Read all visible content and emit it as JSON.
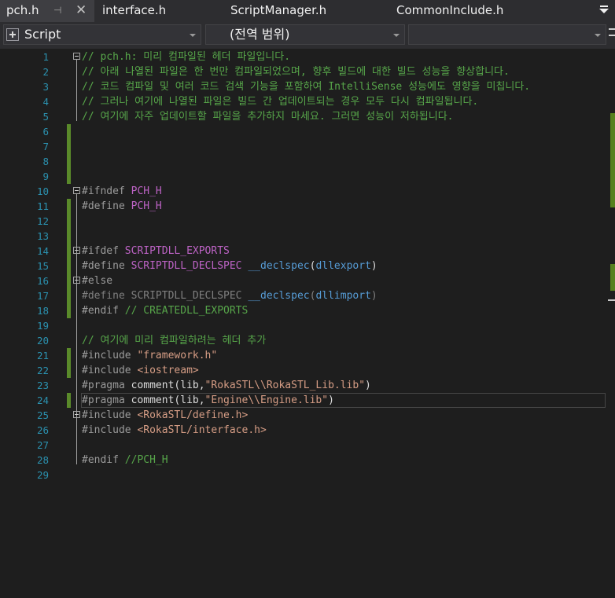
{
  "tabs": [
    {
      "label": "pch.h",
      "active": true
    },
    {
      "label": "interface.h"
    },
    {
      "label": "ScriptManager.h"
    },
    {
      "label": "CommonInclude.h"
    }
  ],
  "navbar": {
    "project": "Script",
    "scope": "(전역 범위)",
    "member": ""
  },
  "colors": {
    "changed": "#5a8a2a",
    "line_number": "#2b91af",
    "comment": "#57a64a",
    "macro": "#bd63c5",
    "string": "#d69d85",
    "keyword": "#569cd6"
  },
  "editor": {
    "line_numbers": [
      "1",
      "2",
      "3",
      "4",
      "5",
      "6",
      "7",
      "8",
      "9",
      "10",
      "11",
      "12",
      "13",
      "14",
      "15",
      "16",
      "17",
      "18",
      "19",
      "20",
      "21",
      "22",
      "23",
      "24",
      "25",
      "26",
      "27",
      "28",
      "29"
    ],
    "lines": [
      {
        "parts": [
          {
            "t": "// pch.h: 미리 컴파일된 헤더 파일입니다.",
            "c": "cmt"
          }
        ]
      },
      {
        "parts": [
          {
            "t": "// 아래 나열된 파일은 한 번만 컴파일되었으며, 향후 빌드에 대한 빌드 성능을 향상합니다.",
            "c": "cmt"
          }
        ]
      },
      {
        "parts": [
          {
            "t": "// 코드 컴파일 및 여러 코드 검색 기능을 포함하여 IntelliSense 성능에도 영향을 미칩니다.",
            "c": "cmt"
          }
        ]
      },
      {
        "parts": [
          {
            "t": "// 그러나 여기에 나열된 파일은 빌드 간 업데이트되는 경우 모두 다시 컴파일됩니다.",
            "c": "cmt"
          }
        ]
      },
      {
        "parts": [
          {
            "t": "// 여기에 자주 업데이트할 파일을 추가하지 마세요. 그러면 성능이 저하됩니다.",
            "c": "cmt"
          }
        ]
      },
      {
        "parts": []
      },
      {
        "parts": []
      },
      {
        "parts": []
      },
      {
        "parts": []
      },
      {
        "parts": [
          {
            "t": "#ifndef ",
            "c": "pre"
          },
          {
            "t": "PCH_H",
            "c": "mac"
          }
        ]
      },
      {
        "parts": [
          {
            "t": "#define ",
            "c": "pre"
          },
          {
            "t": "PCH_H",
            "c": "mac"
          }
        ]
      },
      {
        "parts": []
      },
      {
        "parts": []
      },
      {
        "parts": [
          {
            "t": "#ifdef ",
            "c": "pre"
          },
          {
            "t": "SCRIPTDLL_EXPORTS",
            "c": "mac"
          }
        ]
      },
      {
        "parts": [
          {
            "t": "#define ",
            "c": "pre"
          },
          {
            "t": "SCRIPTDLL_DECLSPEC ",
            "c": "mac"
          },
          {
            "t": "__declspec",
            "c": "kw"
          },
          {
            "t": "(",
            "c": ""
          },
          {
            "t": "dllexport",
            "c": "kw"
          },
          {
            "t": ")",
            "c": ""
          }
        ]
      },
      {
        "parts": [
          {
            "t": "#else",
            "c": "pre"
          }
        ]
      },
      {
        "parts": [
          {
            "t": "#define ",
            "c": "dim"
          },
          {
            "t": "SCRIPTDLL_DECLSPEC ",
            "c": "dim"
          },
          {
            "t": "__declspec",
            "c": "kw"
          },
          {
            "t": "(",
            "c": "dim"
          },
          {
            "t": "dllimport",
            "c": "kw"
          },
          {
            "t": ")",
            "c": "dim"
          }
        ]
      },
      {
        "parts": [
          {
            "t": "#endif ",
            "c": "pre"
          },
          {
            "t": "// CREATEDLL_EXPORTS",
            "c": "cmt"
          }
        ]
      },
      {
        "parts": []
      },
      {
        "parts": [
          {
            "t": "// 여기에 미리 컴파일하려는 헤더 추가",
            "c": "cmt"
          }
        ]
      },
      {
        "parts": [
          {
            "t": "#include ",
            "c": "pre"
          },
          {
            "t": "\"framework.h\"",
            "c": "str"
          }
        ]
      },
      {
        "parts": [
          {
            "t": "#include ",
            "c": "pre"
          },
          {
            "t": "<iostream>",
            "c": "str"
          }
        ]
      },
      {
        "parts": [
          {
            "t": "#pragma ",
            "c": "pre"
          },
          {
            "t": "comment(lib,",
            "c": ""
          },
          {
            "t": "\"RokaSTL\\\\RokaSTL_Lib.lib\"",
            "c": "str"
          },
          {
            "t": ")",
            "c": ""
          }
        ]
      },
      {
        "parts": [
          {
            "t": "#pragma ",
            "c": "pre"
          },
          {
            "t": "comment(lib,",
            "c": ""
          },
          {
            "t": "\"Engine\\\\Engine.lib\"",
            "c": "str"
          },
          {
            "t": ")",
            "c": ""
          }
        ]
      },
      {
        "parts": [
          {
            "t": "#include ",
            "c": "pre"
          },
          {
            "t": "<RokaSTL/define.h>",
            "c": "str"
          }
        ]
      },
      {
        "parts": [
          {
            "t": "#include ",
            "c": "pre"
          },
          {
            "t": "<RokaSTL/interface.h>",
            "c": "str"
          }
        ]
      },
      {
        "parts": []
      },
      {
        "parts": [
          {
            "t": "#endif ",
            "c": "pre"
          },
          {
            "t": "//PCH_H",
            "c": "cmt"
          }
        ]
      },
      {
        "parts": []
      }
    ]
  }
}
